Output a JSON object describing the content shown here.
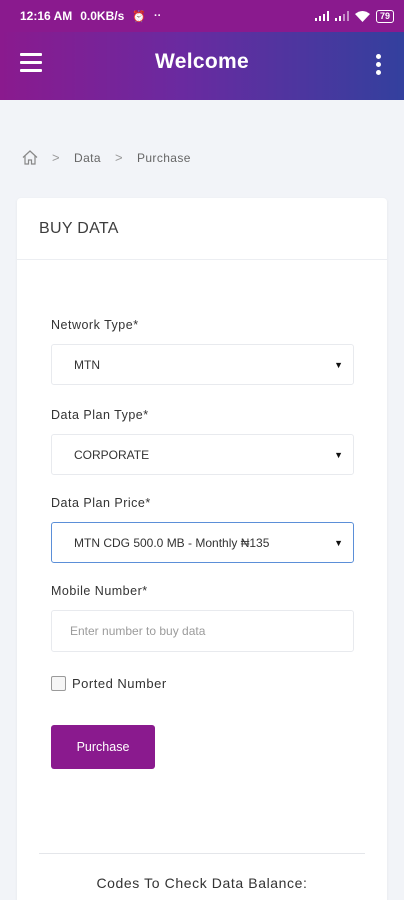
{
  "status_bar": {
    "time": "12:16 AM",
    "speed": "0.0KB/s",
    "alarm_glyph": "⏰",
    "more_glyph": "··",
    "battery": "79"
  },
  "app_bar": {
    "title": "Welcome"
  },
  "breadcrumb": {
    "items": [
      "Data",
      "Purchase"
    ],
    "separator": ">"
  },
  "card": {
    "title": "BUY DATA"
  },
  "form": {
    "network_type": {
      "label": "Network Type*",
      "value": "MTN"
    },
    "plan_type": {
      "label": "Data Plan Type*",
      "value": "CORPORATE"
    },
    "plan_price": {
      "label": "Data Plan Price*",
      "value": "MTN CDG 500.0 MB - Monthly ₦135"
    },
    "mobile_number": {
      "label": "Mobile Number*",
      "placeholder": "Enter number to buy data",
      "value": ""
    },
    "ported": {
      "label": "Ported Number",
      "checked": false
    },
    "caret": "▼",
    "submit_label": "Purchase"
  },
  "codes": {
    "title": "Codes To Check Data Balance:"
  },
  "colors": {
    "brand_purple": "#8a1a8e",
    "gradient_end": "#33409e",
    "focus_border": "#5b8fd8"
  }
}
